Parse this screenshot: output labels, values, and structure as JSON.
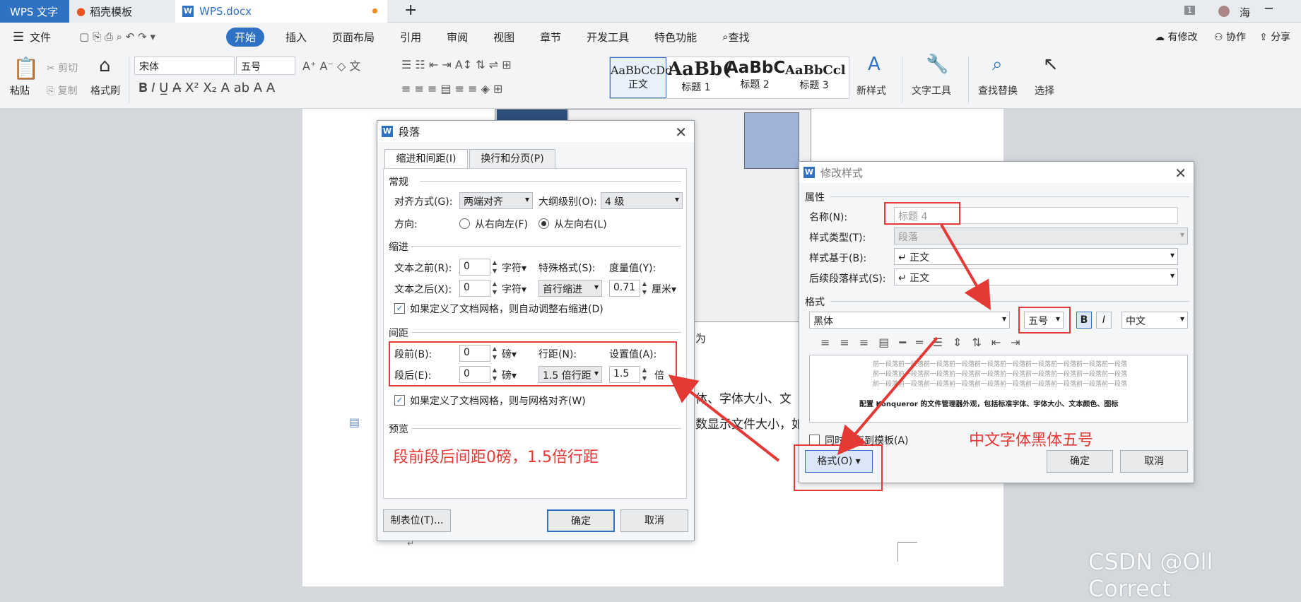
{
  "tabs": {
    "wps": "WPS 文字",
    "daoke": "稻壳模板",
    "doc": "WPS.docx",
    "new": "+",
    "badge": "1",
    "user": "海"
  },
  "menubar": {
    "file": "文件",
    "items": [
      "开始",
      "插入",
      "页面布局",
      "引用",
      "审阅",
      "视图",
      "章节",
      "开发工具",
      "特色功能"
    ],
    "search": "查找",
    "modified": "有修改",
    "collab": "协作",
    "share": "分享"
  },
  "ribbon": {
    "paste": "粘贴",
    "cut": "剪切",
    "copy": "复制",
    "format_painter": "格式刷",
    "font": "宋体",
    "size": "五号",
    "styles": [
      {
        "preview": "AaBbCcDd",
        "name": "正文"
      },
      {
        "preview": "AaBb(",
        "name": "标题 1"
      },
      {
        "preview": "AaBbC",
        "name": "标题 2"
      },
      {
        "preview": "AaBbCcl",
        "name": "标题 3"
      }
    ],
    "new_style": "新样式",
    "text_tools": "文字工具",
    "find_replace": "查找替换",
    "select": "选择"
  },
  "doc": {
    "frag1": "为",
    "frag2": "体、字体大小、文",
    "frag3": "数显示文件大小，如"
  },
  "para": {
    "title": "段落",
    "tab1": "缩进和间距(I)",
    "tab2": "换行和分页(P)",
    "general": "常规",
    "align_label": "对齐方式(G):",
    "align_value": "两端对齐",
    "outline_label": "大纲级别(O):",
    "outline_value": "4 级",
    "direction_label": "方向:",
    "rtl": "从右向左(F)",
    "ltr": "从左向右(L)",
    "indent": "缩进",
    "before_text": "文本之前(R):",
    "before_text_val": "0",
    "after_text": "文本之后(X):",
    "after_text_val": "0",
    "unit_char": "字符",
    "special_label": "特殊格式(S):",
    "special_value": "首行缩进",
    "measure_label": "度量值(Y):",
    "measure_value": "0.71",
    "unit_cm": "厘米",
    "auto_indent": "如果定义了文档网格，则自动调整右缩进(D)",
    "spacing": "间距",
    "before_label": "段前(B):",
    "before_val": "0",
    "after_label": "段后(E):",
    "after_val": "0",
    "unit_pt": "磅",
    "line_label": "行距(N):",
    "line_value": "1.5 倍行距",
    "setval_label": "设置值(A):",
    "setval_value": "1.5",
    "unit_times": "倍",
    "grid_align": "如果定义了文档网格，则与网格对齐(W)",
    "preview": "预览",
    "tabstops": "制表位(T)...",
    "ok": "确定",
    "cancel": "取消"
  },
  "annotations": {
    "para_note": "段前段后间距0磅，1.5倍行距",
    "style_note": "中文字体黑体五号"
  },
  "modstyle": {
    "title": "修改样式",
    "props": "属性",
    "name_label": "名称(N):",
    "name_value": "标题 4",
    "type_label": "样式类型(T):",
    "type_value": "段落",
    "based_label": "样式基于(B):",
    "based_value": "↵ 正文",
    "next_label": "后续段落样式(S):",
    "next_value": "↵ 正文",
    "format": "格式",
    "font": "黑体",
    "size": "五号",
    "bold": "B",
    "italic": "I",
    "lang": "中文",
    "preview_gray": "前一段落前一段落前一段落前一段落前一段落前一段落前一段落前一段落前一段落前一段落",
    "preview_text": "配置 Konqueror 的文件管理器外观，包括标准字体、字体大小、文本颜色、图标",
    "add_template": "同时保存到模板(A)",
    "format_btn": "格式(O)",
    "ok": "确定",
    "cancel": "取消"
  },
  "watermark": "CSDN @Oll Correct",
  "colors": {
    "accent": "#2f72c4",
    "annotation": "#e53935"
  }
}
